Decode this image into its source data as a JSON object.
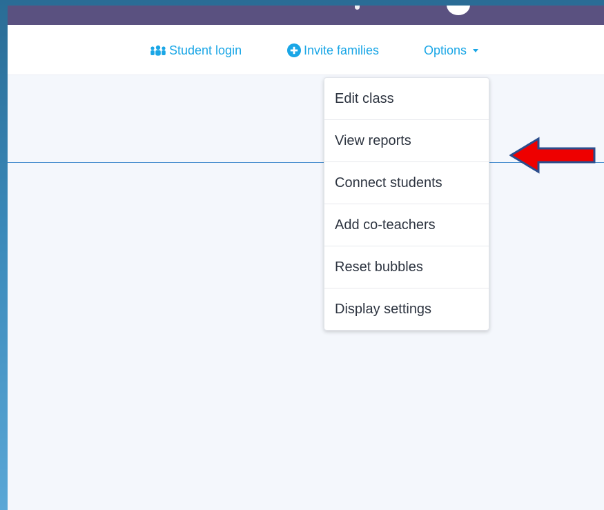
{
  "nav": {
    "student_login": "Student login",
    "invite_families": "Invite families",
    "options": "Options",
    "icons": {
      "student_login": "student-group-icon",
      "invite_families": "plus-circle-icon",
      "options": "caret-down-icon"
    }
  },
  "options_menu": {
    "items": [
      {
        "label": "Edit class"
      },
      {
        "label": "View reports"
      },
      {
        "label": "Connect students"
      },
      {
        "label": "Add co-teachers"
      },
      {
        "label": "Reset bubbles"
      },
      {
        "label": "Display settings"
      }
    ]
  },
  "annotation": {
    "type": "arrow",
    "points_to": "View reports",
    "color": "#ee0000",
    "outline_color": "#2b4d8c"
  },
  "colors": {
    "accent": "#1aa6e6",
    "header": "#5a5180",
    "background": "#f4f7fc",
    "slide_frame": "#3a89b9"
  }
}
